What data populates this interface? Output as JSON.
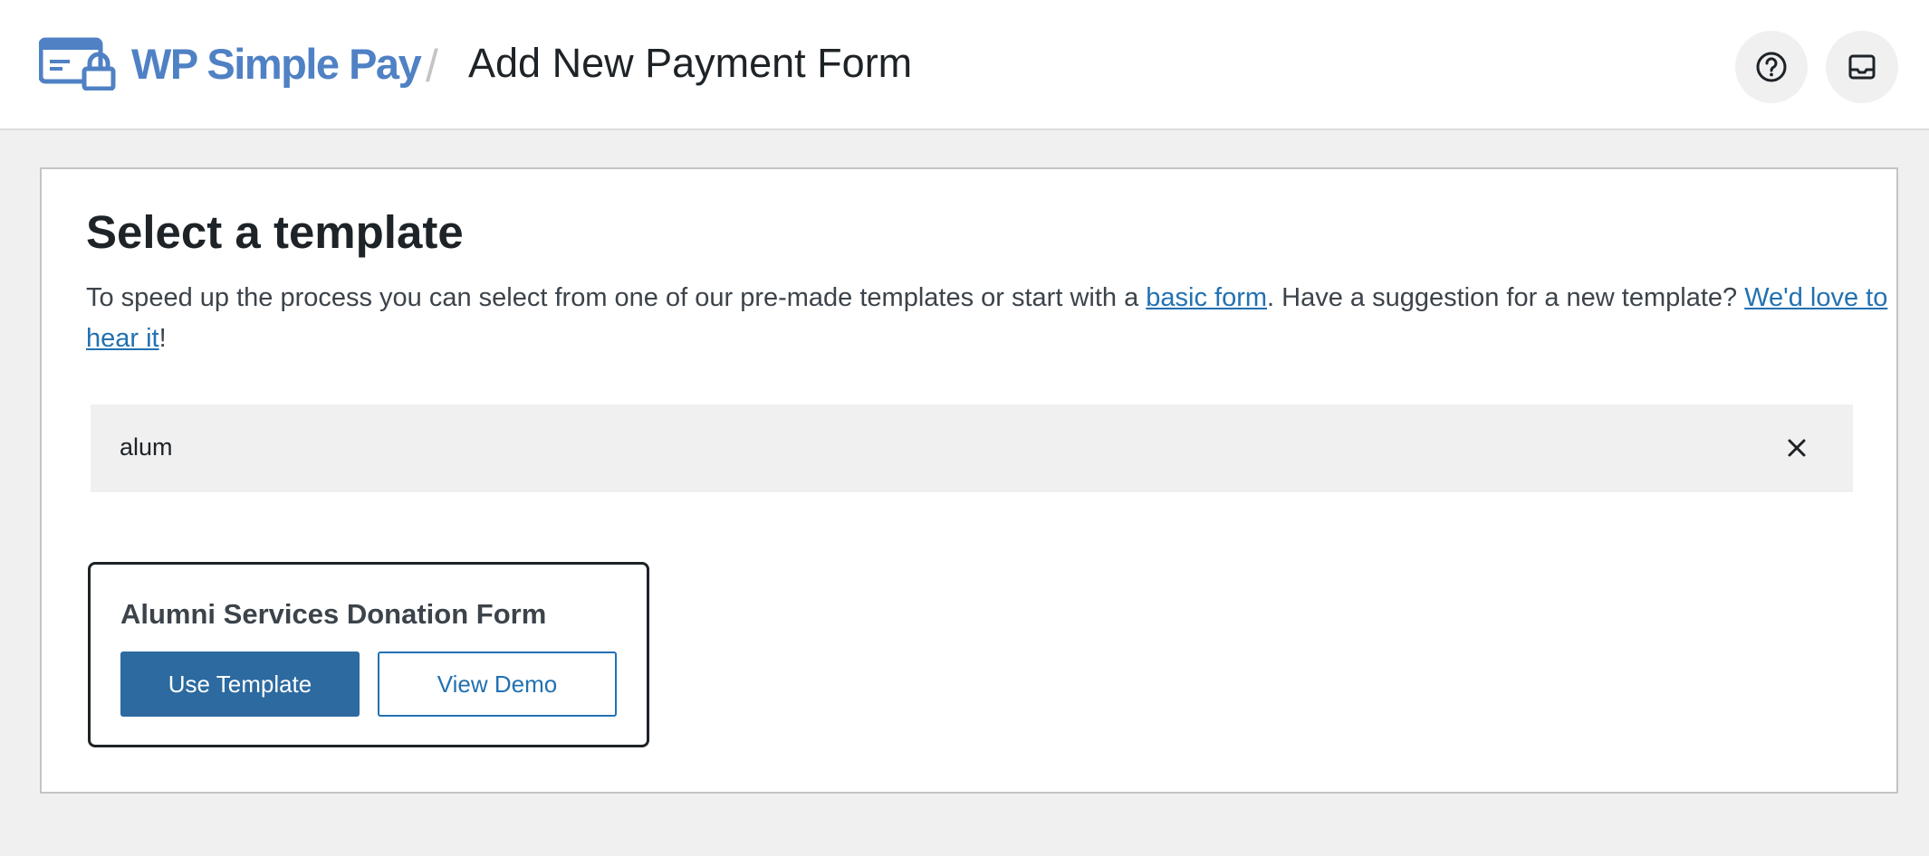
{
  "header": {
    "brand": "WP Simple Pay",
    "separator": "/",
    "title": "Add New Payment Form",
    "icons": {
      "help": "help-circle-icon",
      "inbox": "inbox-icon"
    }
  },
  "main": {
    "heading": "Select a template",
    "description": {
      "part1": "To speed up the process you can select from one of our pre-made templates or start with a ",
      "link1": "basic form",
      "part2": ". Have a suggestion for a new template? ",
      "link2": "We'd love to hear it",
      "part3": "!"
    },
    "search": {
      "value": "alum"
    },
    "results": [
      {
        "title": "Alumni Services Donation Form",
        "use_label": "Use Template",
        "demo_label": "View Demo"
      }
    ]
  },
  "colors": {
    "brand": "#4f81c4",
    "primary": "#2c6aa0",
    "link": "#2271b1",
    "background": "#f0f0f1"
  }
}
